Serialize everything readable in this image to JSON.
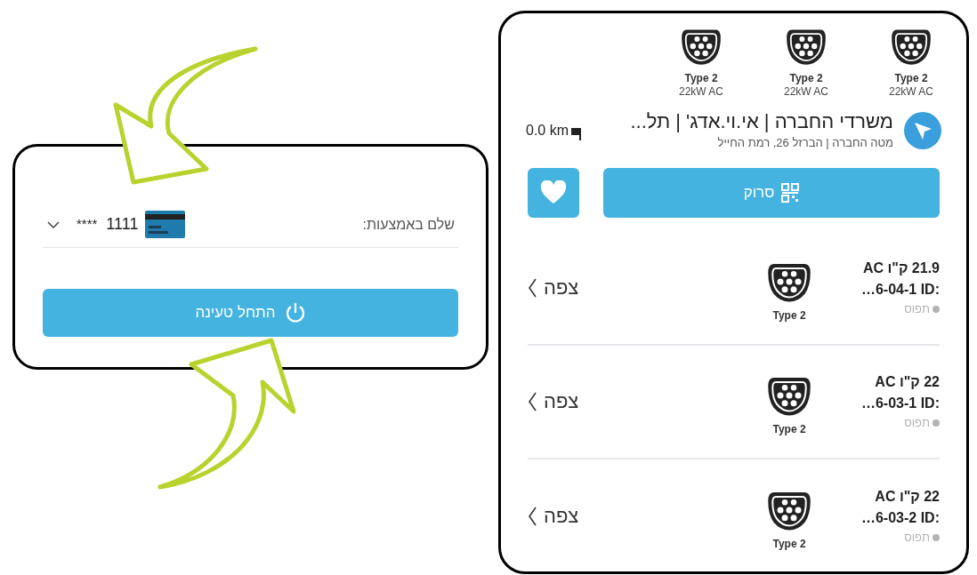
{
  "payment_panel": {
    "label": "שלם באמצעות:",
    "card_number": "1111",
    "card_mask": "****",
    "start_button": "התחל טעינה"
  },
  "station_panel": {
    "connectors": [
      {
        "type": "Type 2",
        "power": "22kW AC"
      },
      {
        "type": "Type 2",
        "power": "22kW AC"
      },
      {
        "type": "Type 2",
        "power": "22kW AC"
      }
    ],
    "title": "משרדי החברה | אי.וי.אדג' | תל...",
    "address": "מטה החברה | הברזל 26, רמת החייל",
    "distance": "0.0 km",
    "scan_button": "סרוק",
    "chargers": [
      {
        "power": "21.9 ק\"ו AC",
        "id": "…6-04-1 ID:",
        "connector": "Type 2",
        "status": "תפוס",
        "color": "#b3b3b3",
        "action": "צפה"
      },
      {
        "power": "22 ק\"ו AC",
        "id": "…6-03-1 ID:",
        "connector": "Type 2",
        "status": "תפוס",
        "color": "#b3b3b3",
        "action": "צפה"
      },
      {
        "power": "22 ק\"ו AC",
        "id": "…6-03-2 ID:",
        "connector": "Type 2",
        "status": "תפוס",
        "color": "#b3b3b3",
        "action": "צפה"
      }
    ]
  }
}
